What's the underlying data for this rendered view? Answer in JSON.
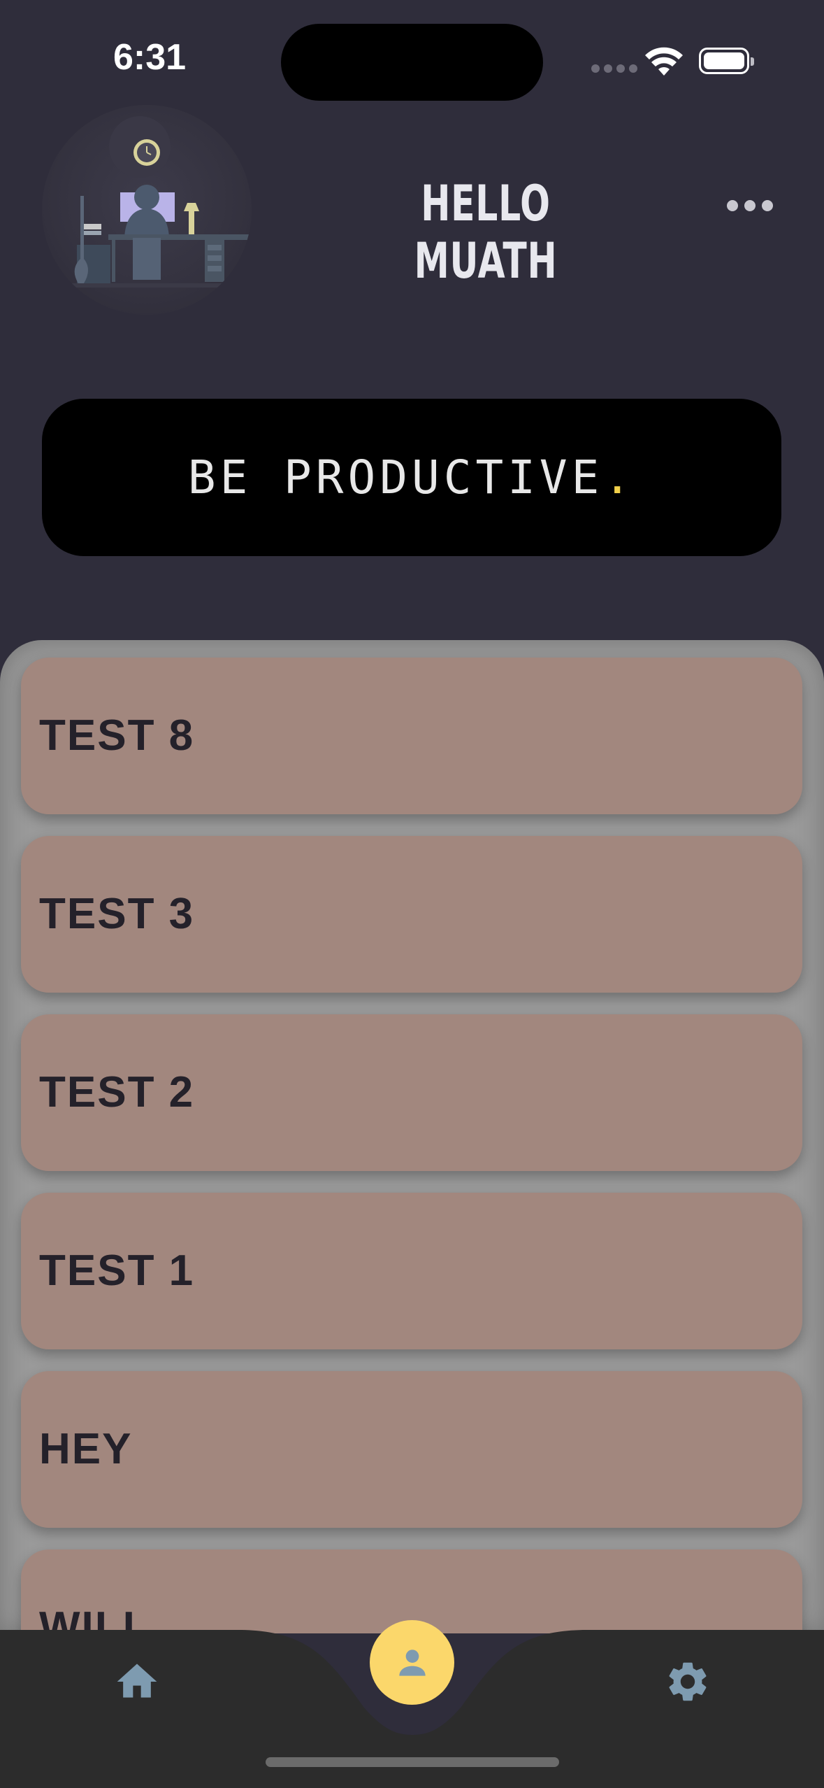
{
  "status_bar": {
    "time": "6:31"
  },
  "header": {
    "greeting": "HELLO MUATH",
    "more_icon": "more-horizontal-icon",
    "avatar_icon": "developer-desk-illustration"
  },
  "banner": {
    "text": "BE PRODUCTIVE",
    "accent": "."
  },
  "tasks": [
    {
      "label": "TEST 8"
    },
    {
      "label": "TEST 3"
    },
    {
      "label": "TEST 2"
    },
    {
      "label": "TEST 1"
    },
    {
      "label": "HEY"
    },
    {
      "label": "WILL"
    }
  ],
  "bottom_nav": {
    "items": [
      {
        "icon": "home-icon"
      },
      {
        "icon": "profile-icon"
      },
      {
        "icon": "settings-icon"
      }
    ]
  },
  "colors": {
    "background": "#2f2d3b",
    "panel": "#9a9a9a",
    "task_card": "#a2877e",
    "accent": "#fbd76b",
    "nav_bar": "#2c2c2c"
  }
}
